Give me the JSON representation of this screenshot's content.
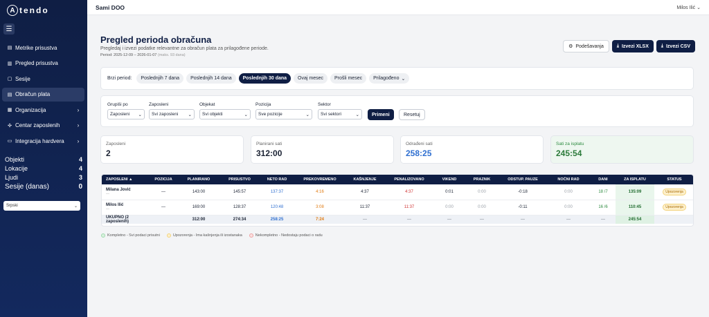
{
  "sidebar": {
    "logo_letter": "A",
    "logo_text": "tendo",
    "nav": [
      {
        "icon": "▤",
        "label": "Metrike prisustva",
        "chevron": ""
      },
      {
        "icon": "▥",
        "label": "Pregled prisustva",
        "chevron": ""
      },
      {
        "icon": "▢",
        "label": "Sesije",
        "chevron": ""
      },
      {
        "icon": "▤",
        "label": "Obračun plata",
        "chevron": ""
      },
      {
        "icon": "▦",
        "label": "Organizacija",
        "chevron": "›"
      },
      {
        "icon": "✣",
        "label": "Centar zaposlenih",
        "chevron": "›"
      },
      {
        "icon": "▭",
        "label": "Integracija hardvera",
        "chevron": "›"
      }
    ],
    "active_item": "Obračun plata",
    "stats": [
      {
        "label": "Objekti",
        "value": "4"
      },
      {
        "label": "Lokacije",
        "value": "4"
      },
      {
        "label": "Ljudi",
        "value": "3"
      },
      {
        "label": "Sesije (danas)",
        "value": "0"
      }
    ],
    "language": "Srpski"
  },
  "topbar": {
    "company": "Sami DOO",
    "user": "Milos Ilić"
  },
  "header": {
    "title": "Pregled perioda obračuna",
    "subtitle": "Pregledaj i izvezi podatke relevantne za obračun plata za prilagođene periode.",
    "period": "Period: 2025-12-09 – 2026-01-07",
    "period_note": "(maks. 93 dana)",
    "settings_label": "Podešavanja",
    "export_xlsx": "Izvezi XLSX",
    "export_csv": "Izvezi CSV"
  },
  "period_filter": {
    "label": "Brzi period:",
    "options": [
      "Poslednjih 7 dana",
      "Poslednjih 14 dana",
      "Poslednjih 30 dana",
      "Ovaj mesec",
      "Prošli mesec",
      "Prilagođeno"
    ],
    "selected": "Poslednjih 30 dana"
  },
  "filters": {
    "group_by": {
      "label": "Grupiši po",
      "value": "Zaposleni"
    },
    "employees": {
      "label": "Zaposleni",
      "value": "Svi zaposleni"
    },
    "object": {
      "label": "Objekat",
      "value": "Svi objekti"
    },
    "position": {
      "label": "Pozicija",
      "value": "Sve pozicije"
    },
    "sector": {
      "label": "Sektor",
      "value": "Svi sektori"
    },
    "apply": "Primeni",
    "reset": "Resetuj"
  },
  "summary": [
    {
      "label": "Zaposleni",
      "value": "2"
    },
    {
      "label": "Planirani sati",
      "value": "312:00"
    },
    {
      "label": "Odrađeni sati",
      "value": "258:25"
    },
    {
      "label": "Sati za isplatu",
      "value": "245:54"
    }
  ],
  "table": {
    "headers": [
      "ZAPOSLENI ▲",
      "POZICIJA",
      "PLANIRANO",
      "PRISUSTVO",
      "NETO RAD",
      "PREKOVREMENO",
      "KAŠNJENJE",
      "PENALIZOVANO",
      "VIKEND",
      "PRAZNIK",
      "ODSTUP. PAUZE",
      "NOĆNI RAD",
      "DANI",
      "ZA ISPLATU",
      "STATUS"
    ],
    "rows": [
      {
        "name": "Milana Jović",
        "sub": "—",
        "position": "—",
        "planned": "143:00",
        "attendance": "145:57",
        "net": "137:37",
        "overtime": "4:16",
        "late": "4:37",
        "penalized": "4:37",
        "weekend": "0:01",
        "holiday": "0:00",
        "break_dev": "-0:18",
        "night": "0:00",
        "days": "18 /7",
        "payout": "135:09",
        "status": "Upozorenja"
      },
      {
        "name": "Milos Ilić",
        "sub": "—",
        "position": "—",
        "planned": "169:00",
        "attendance": "128:37",
        "net": "120:48",
        "overtime": "3:08",
        "late": "11:37",
        "penalized": "11:37",
        "weekend": "0:00",
        "holiday": "0:00",
        "break_dev": "-0:11",
        "night": "0:00",
        "days": "16 /6",
        "payout": "110:45",
        "status": "Upozorenja"
      }
    ],
    "total": {
      "label": "UKUPNO (2 zaposlenih)",
      "planned": "312:00",
      "attendance": "274:34",
      "net": "258:25",
      "overtime": "7:24",
      "late": "—",
      "penalized": "—",
      "weekend": "—",
      "holiday": "—",
      "break_dev": "—",
      "night": "—",
      "days": "—",
      "payout": "245:54"
    }
  },
  "legend": [
    {
      "text": "Kompletno - Svi podaci prisutni",
      "color": "#b7e4c2"
    },
    {
      "text": "Upozorenja - Ima kašnjenja ili izostanaka",
      "color": "#f7dd8a"
    },
    {
      "text": "Nekompletno - Nedostaju podaci o radu",
      "color": "#f2b5b5"
    }
  ]
}
